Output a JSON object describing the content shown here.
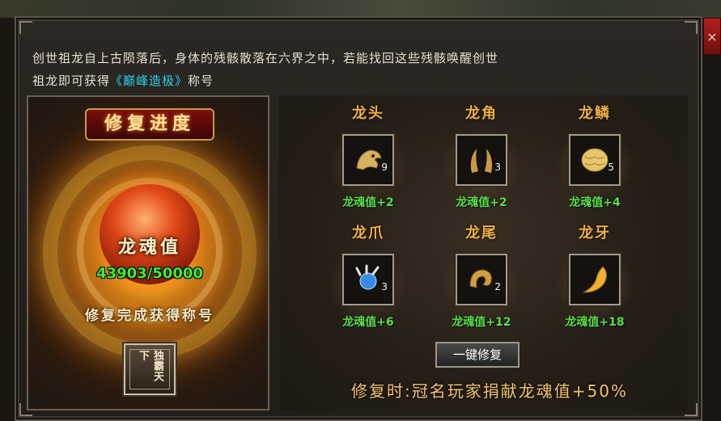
{
  "intro": {
    "line1": "创世祖龙自上古陨落后，身体的残骸散落在六界之中，若能找回这些残骸唤醒创世",
    "line2_prefix": "祖龙即可获得",
    "line2_title": "《巅峰造极》",
    "line2_suffix": "称号"
  },
  "close": {
    "symbol": "×"
  },
  "progress": {
    "title": "修复进度",
    "soul_label": "龙魂值",
    "soul_value": "43903/50000",
    "soul_current": 43903,
    "soul_total": 50000,
    "reward_text": "修复完成获得称号",
    "badge_text": "独霸天下"
  },
  "parts": [
    {
      "name": "龙头",
      "count": "9",
      "bonus": "龙魂值+2",
      "icon": "dragon-head-icon",
      "color": "#d8b060"
    },
    {
      "name": "龙角",
      "count": "3",
      "bonus": "龙魂值+2",
      "icon": "dragon-horn-icon",
      "color": "#c89a48"
    },
    {
      "name": "龙鳞",
      "count": "5",
      "bonus": "龙魂值+4",
      "icon": "dragon-scale-icon",
      "color": "#e6c66a"
    },
    {
      "name": "龙爪",
      "count": "3",
      "bonus": "龙魂值+6",
      "icon": "dragon-claw-icon",
      "color": "#3a8ae8"
    },
    {
      "name": "龙尾",
      "count": "2",
      "bonus": "龙魂值+12",
      "icon": "dragon-tail-icon",
      "color": "#d0a040"
    },
    {
      "name": "龙牙",
      "count": "",
      "bonus": "龙魂值+18",
      "icon": "dragon-fang-icon",
      "color": "#f0b030"
    }
  ],
  "actions": {
    "repair_all": "一键修复",
    "contribution": "修复时:冠名玩家捐献龙魂值+50%"
  }
}
